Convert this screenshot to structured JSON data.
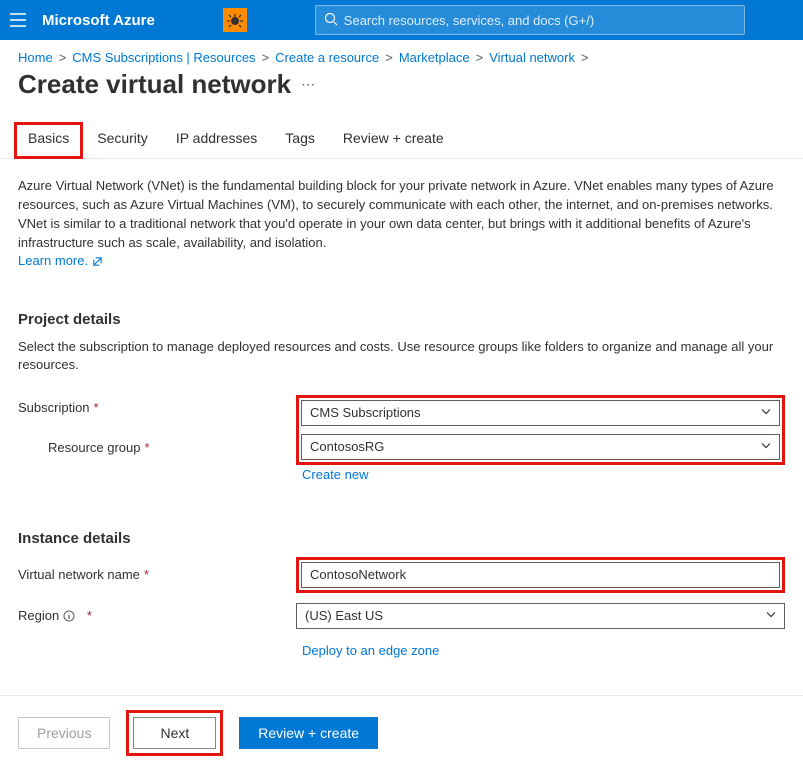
{
  "header": {
    "brand": "Microsoft Azure",
    "search_placeholder": "Search resources, services, and docs (G+/)"
  },
  "breadcrumb": {
    "items": [
      "Home",
      "CMS Subscriptions | Resources",
      "Create a resource",
      "Marketplace",
      "Virtual network"
    ]
  },
  "page": {
    "title": "Create virtual network"
  },
  "tabs": {
    "items": [
      "Basics",
      "Security",
      "IP addresses",
      "Tags",
      "Review + create"
    ],
    "active": "Basics"
  },
  "description": {
    "text": "Azure Virtual Network (VNet) is the fundamental building block for your private network in Azure. VNet enables many types of Azure resources, such as Azure Virtual Machines (VM), to securely communicate with each other, the internet, and on-premises networks. VNet is similar to a traditional network that you'd operate in your own data center, but brings with it additional benefits of Azure's infrastructure such as scale, availability, and isolation.",
    "learn_more": "Learn more."
  },
  "project_details": {
    "heading": "Project details",
    "desc": "Select the subscription to manage deployed resources and costs. Use resource groups like folders to organize and manage all your resources.",
    "subscription_label": "Subscription",
    "subscription_value": "CMS Subscriptions",
    "resource_group_label": "Resource group",
    "resource_group_value": "ContososRG",
    "create_new": "Create new"
  },
  "instance_details": {
    "heading": "Instance details",
    "vnet_name_label": "Virtual network name",
    "vnet_name_value": "ContosoNetwork",
    "region_label": "Region",
    "region_value": "(US) East US",
    "edge_link": "Deploy to an edge zone"
  },
  "footer": {
    "previous": "Previous",
    "next": "Next",
    "review": "Review + create"
  }
}
